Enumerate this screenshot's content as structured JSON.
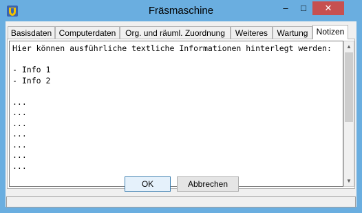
{
  "window": {
    "title": "Fräsmaschine",
    "icon": "app-shield-icon",
    "controls": {
      "minimize": "–",
      "maximize": "□",
      "close": "✕"
    },
    "accent_color": "#6aaee0",
    "close_color": "#c75050"
  },
  "tabs": [
    {
      "label": "Basisdaten"
    },
    {
      "label": "Computerdaten"
    },
    {
      "label": "Org. und räuml. Zuordnung"
    },
    {
      "label": "Weiteres"
    },
    {
      "label": "Wartung"
    },
    {
      "label": "Notizen",
      "active": true
    }
  ],
  "notes": {
    "lines": [
      "Hier können ausführliche textliche Informationen hinterlegt werden:",
      "",
      "- Info 1",
      "- Info 2",
      "",
      "...",
      "...",
      "...",
      "...",
      "...",
      "...",
      "..."
    ]
  },
  "buttons": {
    "ok": "OK",
    "cancel": "Abbrechen"
  },
  "scrollbar": {
    "up": "▲",
    "down": "▼"
  }
}
